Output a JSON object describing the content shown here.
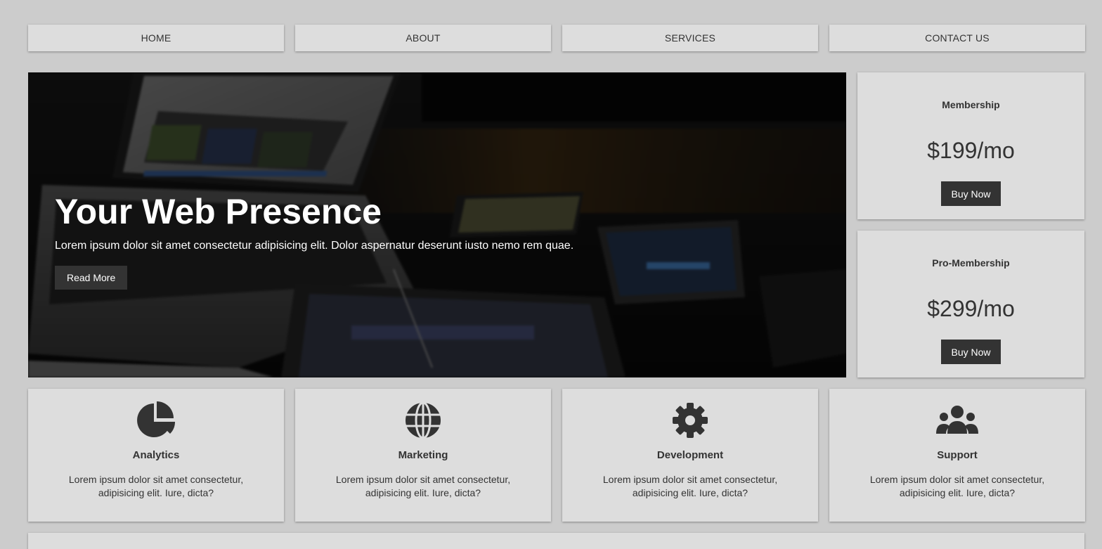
{
  "nav": {
    "items": [
      {
        "label": "HOME"
      },
      {
        "label": "ABOUT"
      },
      {
        "label": "SERVICES"
      },
      {
        "label": "CONTACT US"
      }
    ]
  },
  "hero": {
    "title": "Your Web Presence",
    "text": "Lorem ipsum dolor sit amet consectetur adipisicing elit. Dolor aspernatur deserunt iusto nemo rem quae.",
    "button_label": "Read More"
  },
  "pricing": [
    {
      "name": "Membership",
      "price": "$199/mo",
      "button_label": "Buy Now"
    },
    {
      "name": "Pro-Membership",
      "price": "$299/mo",
      "button_label": "Buy Now"
    }
  ],
  "services": [
    {
      "icon": "chart-pie-icon",
      "title": "Analytics",
      "text": "Lorem ipsum dolor sit amet consectetur, adipisicing elit. Iure, dicta?"
    },
    {
      "icon": "globe-icon",
      "title": "Marketing",
      "text": "Lorem ipsum dolor sit amet consectetur, adipisicing elit. Iure, dicta?"
    },
    {
      "icon": "gear-icon",
      "title": "Development",
      "text": "Lorem ipsum dolor sit amet consectetur, adipisicing elit. Iure, dicta?"
    },
    {
      "icon": "users-icon",
      "title": "Support",
      "text": "Lorem ipsum dolor sit amet consectetur, adipisicing elit. Iure, dicta?"
    }
  ],
  "colors": {
    "page_background": "#cccccc",
    "card_background": "#dddddd",
    "button_dark": "#333333",
    "text": "#333333"
  }
}
